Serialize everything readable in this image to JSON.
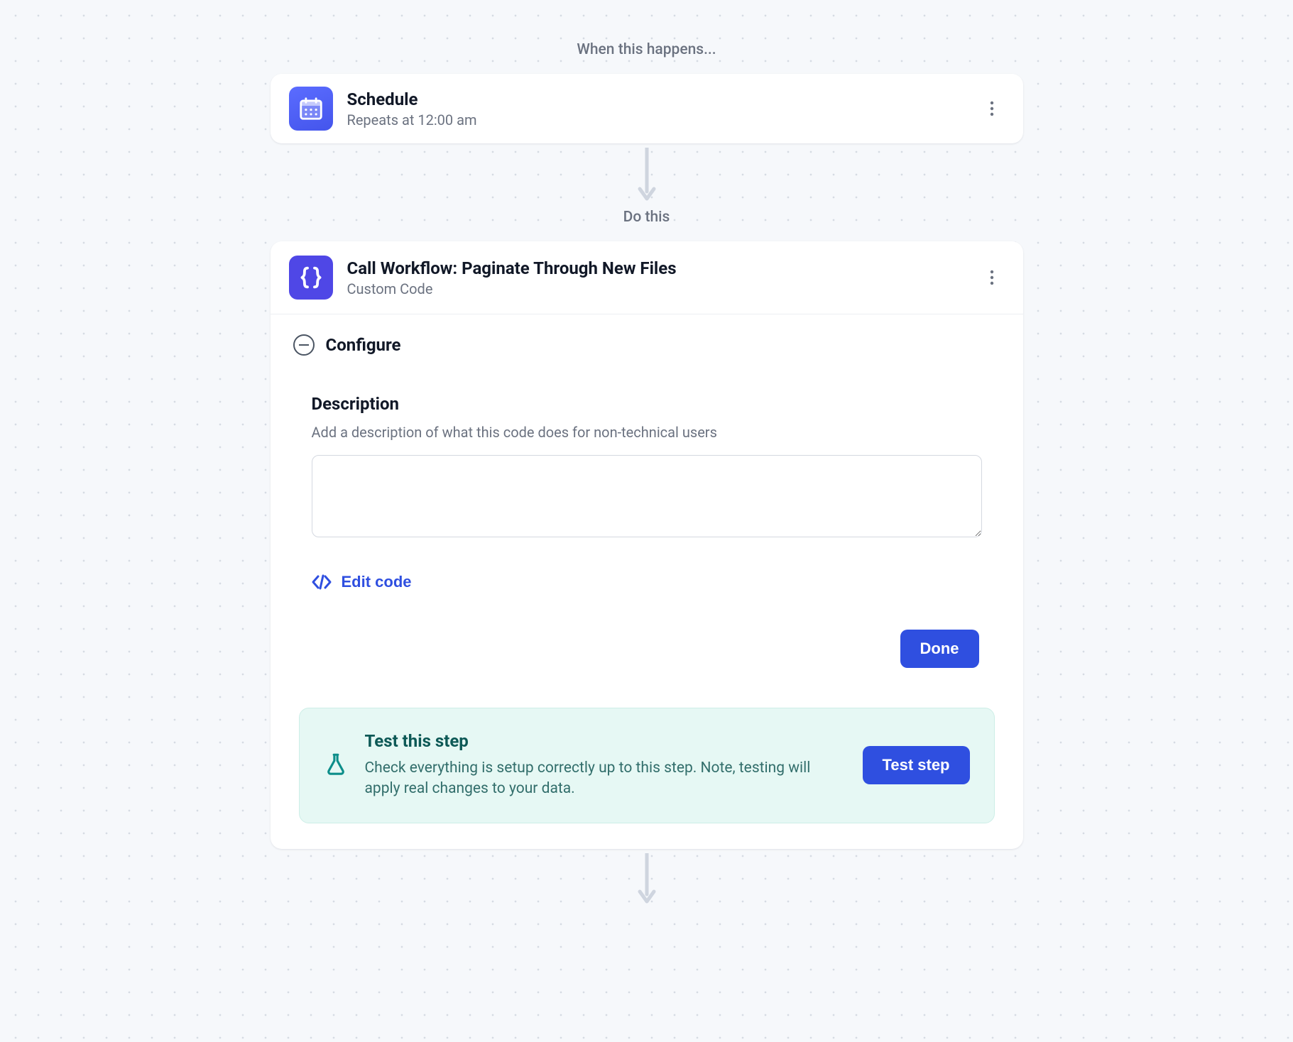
{
  "sections": {
    "trigger_label": "When this happens...",
    "action_label": "Do this"
  },
  "trigger": {
    "title": "Schedule",
    "subtitle": "Repeats at 12:00 am"
  },
  "action": {
    "title": "Call Workflow: Paginate Through New Files",
    "subtitle": "Custom Code",
    "configure": {
      "heading": "Configure",
      "description_label": "Description",
      "description_help": "Add a description of what this code does for non-technical users",
      "description_value": "",
      "edit_code_label": "Edit code",
      "done_label": "Done"
    },
    "test": {
      "title": "Test this step",
      "description": "Check everything is setup correctly up to this step. Note, testing will apply real changes to your data.",
      "button_label": "Test step"
    }
  }
}
